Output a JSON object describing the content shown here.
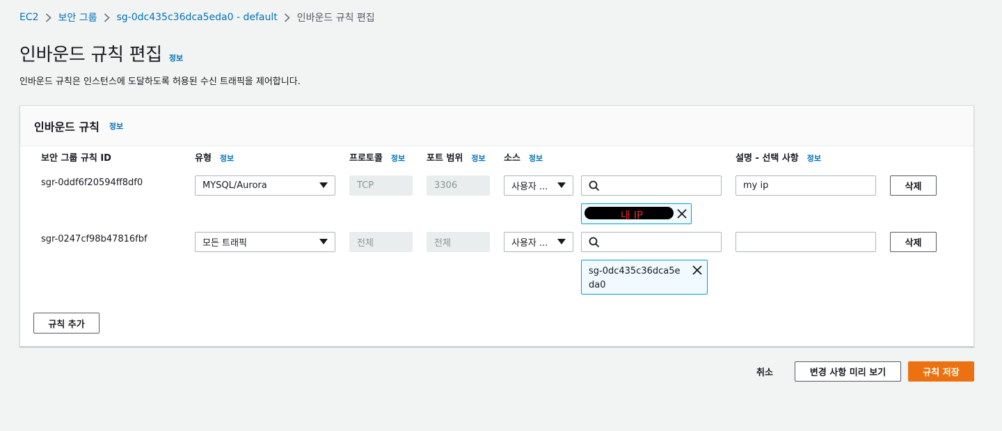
{
  "breadcrumb": {
    "items": [
      "EC2",
      "보안 그룹",
      "sg-0dc435c36dca5eda0 - default"
    ],
    "current": "인바운드 규칙 편집"
  },
  "page": {
    "title": "인바운드 규칙 편집",
    "info": "정보",
    "description": "인바운드 규칙은 인스턴스에 도달하도록 허용된 수신 트래픽을 제어합니다."
  },
  "panel": {
    "title": "인바운드 규칙",
    "info": "정보",
    "columns": {
      "id": "보안 그룹 규칙 ID",
      "type": "유형",
      "protocol": "프로토콜",
      "port": "포트 범위",
      "source": "소스",
      "description": "설명 - 선택 사항"
    },
    "rules": [
      {
        "id": "sgr-0ddf6f20594ff8df0",
        "type": "MYSQL/Aurora",
        "protocol": "TCP",
        "port": "3306",
        "source_type": "사용자 ...",
        "source_search": "",
        "source_token": "내 IP",
        "description": "my ip",
        "delete_label": "삭제"
      },
      {
        "id": "sgr-0247cf98b47816fbf",
        "type": "모든 트래픽",
        "protocol": "전체",
        "port": "전체",
        "source_type": "사용자 ...",
        "source_search": "",
        "source_token": "sg-0dc435c36dca5eda0",
        "description": "",
        "delete_label": "삭제"
      }
    ],
    "add_rule_label": "규칙 추가"
  },
  "footer": {
    "cancel_label": "취소",
    "preview_label": "변경 사항 미리 보기",
    "save_label": "규칙 저장"
  },
  "colors": {
    "link": "#0073bb",
    "primary": "#ec7211",
    "token_border": "#00a1c9"
  }
}
